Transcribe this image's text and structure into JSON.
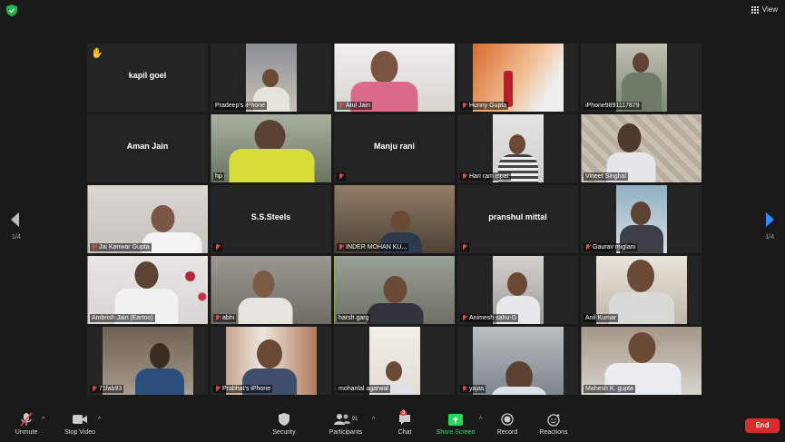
{
  "top": {
    "view_label": "View"
  },
  "nav": {
    "left_page": "1/4",
    "right_page": "1/4"
  },
  "tiles": [
    {
      "name": "kapil goel",
      "hand": true
    },
    {
      "label": "Pradeep's iPhone"
    },
    {
      "label": "Atul Jain",
      "muted": true
    },
    {
      "label": "Hunny Gupta",
      "muted": true
    },
    {
      "label": "iPhone9891117879"
    },
    {
      "name": "Aman Jain"
    },
    {
      "label": "hp",
      "muted": true
    },
    {
      "name": "Manju rani",
      "muted": true
    },
    {
      "label": "Hari ram ispat",
      "muted": true
    },
    {
      "label": "Vineet Singhal"
    },
    {
      "label": "Jai Kanwar Gupta",
      "muted": true
    },
    {
      "name": "S.S.Steels",
      "muted": true
    },
    {
      "label": "INDER MOHAN KU...",
      "muted": true
    },
    {
      "name": "pranshul mittal",
      "muted": true
    },
    {
      "label": "Gaurav miglani",
      "muted": true
    },
    {
      "label": "Ambrish Jain (Eartoo)"
    },
    {
      "label": "abhi",
      "muted": true
    },
    {
      "label": "harsh garg",
      "active": true
    },
    {
      "label": "Animesh sahu-G",
      "muted": true
    },
    {
      "label": "Anil Kumar"
    },
    {
      "label": "71fab93",
      "muted": true
    },
    {
      "label": "Prabhat's iPhone",
      "muted": true
    },
    {
      "label": "mohanlal agarwal"
    },
    {
      "label": "yajas",
      "muted": true
    },
    {
      "label": "Mahesh K. gupta"
    }
  ],
  "toolbar": {
    "unmute": "Unmute",
    "stop_video": "Stop Video",
    "security": "Security",
    "participants": "Participants",
    "participants_count": "91",
    "chat": "Chat",
    "chat_badge": "3",
    "share_screen": "Share Screen",
    "record": "Record",
    "reactions": "Reactions",
    "end": "End"
  },
  "colors": {
    "share": "#23d959",
    "end": "#d92d2d",
    "active_border": "#9acd32",
    "next_arrow": "#2d8cff"
  }
}
